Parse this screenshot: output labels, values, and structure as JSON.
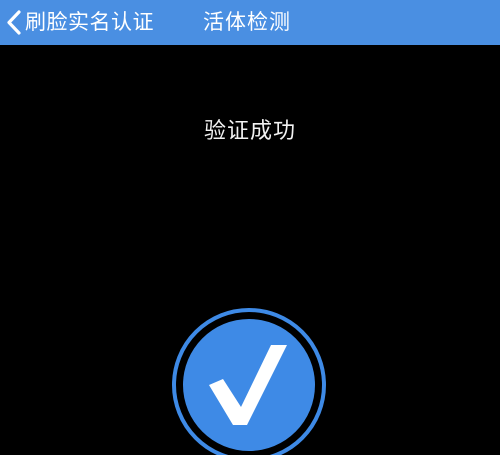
{
  "navbar": {
    "back_label": "刷脸实名认证",
    "title": "活体检测",
    "back_icon": "chevron-left-icon"
  },
  "main": {
    "status_text": "验证成功",
    "success_icon": "checkmark-icon"
  },
  "colors": {
    "navbar_bg": "#4a8fe2",
    "badge_fill": "#3e8ae6",
    "badge_ring": "#3e8ae6",
    "background": "#000000",
    "text": "#ffffff"
  }
}
